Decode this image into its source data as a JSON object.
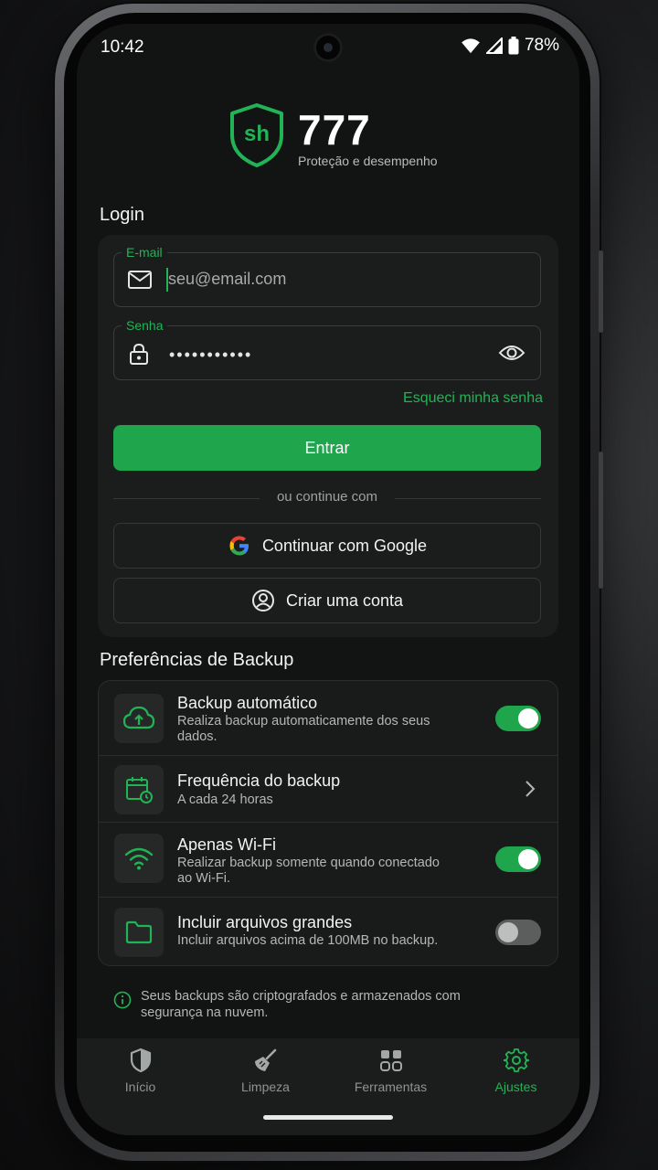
{
  "status_bar": {
    "time": "10:42",
    "battery": "78%"
  },
  "brand": {
    "logo_letters": "sh",
    "title": "777",
    "subtitle": "Proteção e desempenho"
  },
  "login": {
    "section_title": "Login",
    "email_label": "E-mail",
    "email_placeholder": "seu@email.com",
    "password_label": "Senha",
    "password_mask": "•••••••••••",
    "forgot_password": "Esqueci minha senha",
    "submit_label": "Entrar",
    "divider_text": "ou continue com",
    "google_label": "Continuar com Google",
    "create_account_label": "Criar uma conta"
  },
  "backup": {
    "section_title": "Preferências de Backup",
    "items": [
      {
        "icon": "cloud-upload-icon",
        "title": "Backup automático",
        "description": "Realiza backup automaticamente dos seus dados.",
        "control": "toggle",
        "enabled": true
      },
      {
        "icon": "calendar-clock-icon",
        "title": "Frequência do backup",
        "description": "A cada 24 horas",
        "control": "chevron"
      },
      {
        "icon": "wifi-icon",
        "title": "Apenas Wi-Fi",
        "description": "Realizar backup somente quando conectado ao Wi-Fi.",
        "control": "toggle",
        "enabled": true
      },
      {
        "icon": "folder-icon",
        "title": "Incluir arquivos grandes",
        "description": "Incluir arquivos acima de 100MB no backup.",
        "control": "toggle",
        "enabled": false
      }
    ],
    "info_text": "Seus backups são criptografados e armazenados com segurança na nuvem."
  },
  "nav": {
    "items": [
      {
        "label": "Início",
        "icon": "shield-icon",
        "active": false
      },
      {
        "label": "Limpeza",
        "icon": "broom-icon",
        "active": false
      },
      {
        "label": "Ferramentas",
        "icon": "grid-icon",
        "active": false
      },
      {
        "label": "Ajustes",
        "icon": "gear-icon",
        "active": true
      }
    ]
  },
  "colors": {
    "accent": "#22b356",
    "button": "#1fa54b",
    "background": "#121413",
    "card": "#1b1d1c"
  }
}
